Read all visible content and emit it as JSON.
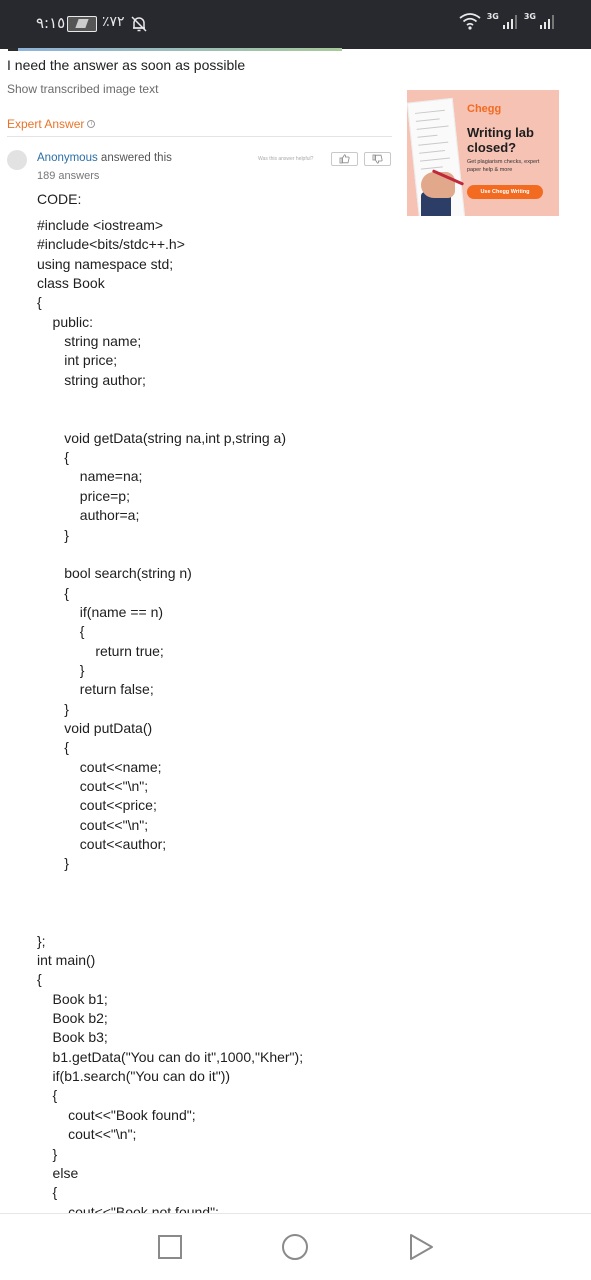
{
  "status_bar": {
    "time": "٩:١٥",
    "battery": "٪٧٢",
    "network1": "3G",
    "network2": "3G"
  },
  "question": {
    "text": "I need the answer as soon as possible",
    "show_image_link": "Show transcribed image text"
  },
  "expert_answer": {
    "heading": "Expert Answer",
    "answerer_name": "Anonymous",
    "answered_label": " answered this",
    "answers_count": "189 answers",
    "helpful_prompt": "Was this answer helpful?"
  },
  "ad": {
    "brand": "Chegg",
    "headline": "Writing lab closed?",
    "subtext": "Get plagiarism checks, expert paper help & more",
    "cta": "Use Chegg Writing"
  },
  "answer": {
    "title": "CODE:",
    "code_lines": [
      "#include <iostream>",
      "#include<bits/stdc++.h>",
      "using namespace std;",
      "class Book",
      "{",
      "    public:",
      "       string name;",
      "       int price;",
      "       string author;",
      "",
      "",
      "       void getData(string na,int p,string a)",
      "       {",
      "           name=na;",
      "           price=p;",
      "           author=a;",
      "       }",
      "",
      "       bool search(string n)",
      "       {",
      "           if(name == n)",
      "           {",
      "               return true;",
      "           }",
      "           return false;",
      "       }",
      "       void putData()",
      "       {",
      "           cout<<name;",
      "           cout<<\"\\n\";",
      "           cout<<price;",
      "           cout<<\"\\n\";",
      "           cout<<author;",
      "       }",
      "",
      "",
      "",
      "};",
      "int main()",
      "{",
      "    Book b1;",
      "    Book b2;",
      "    Book b3;",
      "    b1.getData(\"You can do it\",1000,\"Kher\");",
      "    if(b1.search(\"You can do it\"))",
      "    {",
      "        cout<<\"Book found\";",
      "        cout<<\"\\n\";",
      "    }",
      "    else",
      "    {",
      "        cout<<\"Book not found\";"
    ]
  }
}
